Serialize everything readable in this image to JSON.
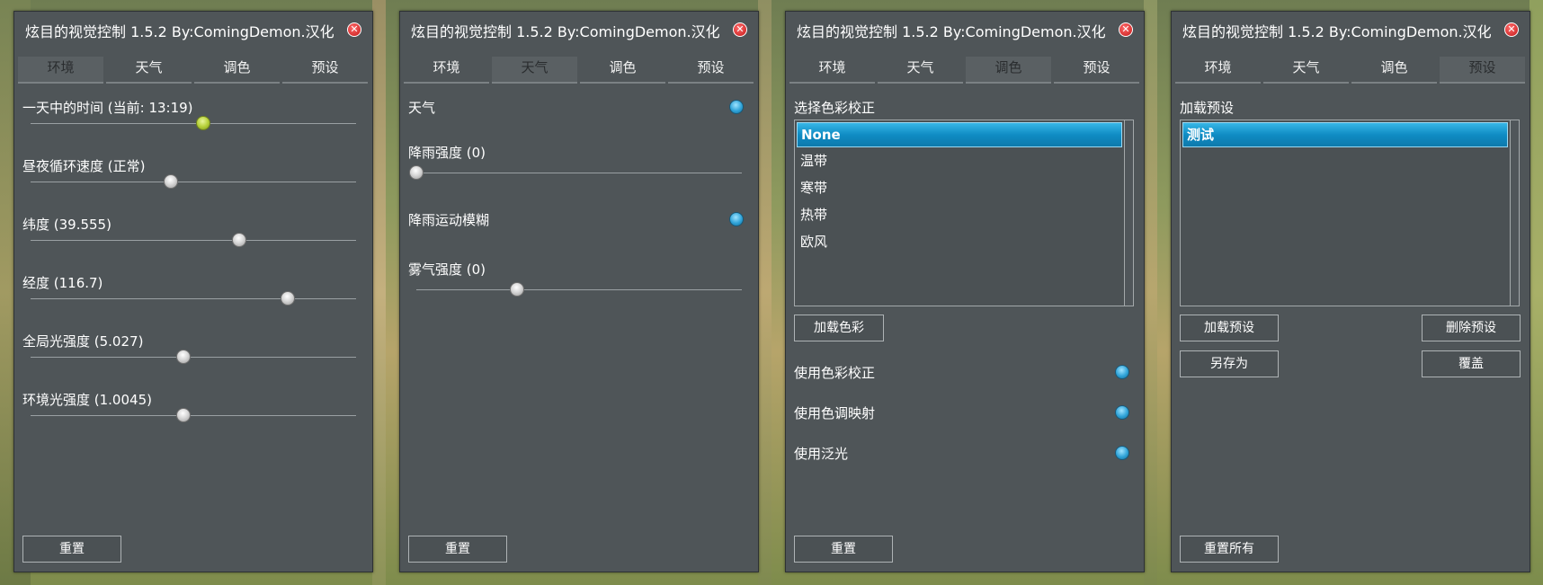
{
  "window_title": "炫目的视觉控制 1.5.2 By:ComingDemon.汉化",
  "tabs": [
    "环境",
    "天气",
    "调色",
    "预设"
  ],
  "panel1": {
    "active_tab": 0,
    "sliders": [
      {
        "label": "一天中的时间 (当前: 13:19)",
        "value": 0.53,
        "color": "green"
      },
      {
        "label": "昼夜循环速度 (正常)",
        "value": 0.43
      },
      {
        "label": "纬度 (39.555)",
        "value": 0.64
      },
      {
        "label": "经度 (116.7)",
        "value": 0.79
      },
      {
        "label": "全局光强度 (5.027)",
        "value": 0.47
      },
      {
        "label": "环境光强度 (1.0045)",
        "value": 0.47
      }
    ],
    "reset_label": "重置"
  },
  "panel2": {
    "active_tab": 1,
    "weather_label": "天气",
    "rain_label": "降雨强度 (0)",
    "rain_value": 0.0,
    "rain_blur_label": "降雨运动模糊",
    "fog_label": "雾气强度 (0)",
    "fog_value": 0.31,
    "reset_label": "重置"
  },
  "panel3": {
    "active_tab": 2,
    "section_label": "选择色彩校正",
    "items": [
      "None",
      "温带",
      "寒带",
      "热带",
      "欧风"
    ],
    "selected_index": 0,
    "load_button": "加载色彩",
    "toggles": [
      "使用色彩校正",
      "使用色调映射",
      "使用泛光"
    ],
    "reset_label": "重置"
  },
  "panel4": {
    "active_tab": 3,
    "section_label": "加载预设",
    "items": [
      "测试"
    ],
    "selected_index": 0,
    "load_button": "加载预设",
    "delete_button": "删除预设",
    "save_as_button": "另存为",
    "overwrite_button": "覆盖",
    "reset_all_label": "重置所有"
  },
  "colors": {
    "panel_bg": "#4f5558",
    "toggle_blue": "#2fa3d8",
    "selection_blue": "#0f8cc4",
    "close_red": "#d42020"
  }
}
